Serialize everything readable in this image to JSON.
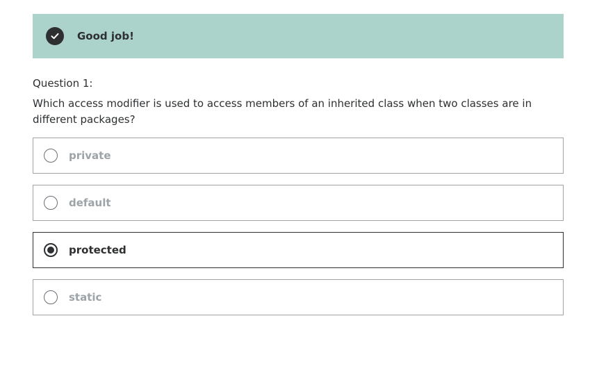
{
  "alert": {
    "text": "Good job!",
    "icon": "checkmark-circle-icon",
    "background": "#acd2cc"
  },
  "question": {
    "label": "Question 1:",
    "text": "Which access modifier is used to access members of an inherited class when two classes are in different packages?"
  },
  "options": [
    {
      "label": "private",
      "selected": false
    },
    {
      "label": "default",
      "selected": false
    },
    {
      "label": "protected",
      "selected": true
    },
    {
      "label": "static",
      "selected": false
    }
  ],
  "colors": {
    "text": "#2d2f31",
    "muted": "#9da3a7",
    "alert_bg": "#acd2cc"
  }
}
